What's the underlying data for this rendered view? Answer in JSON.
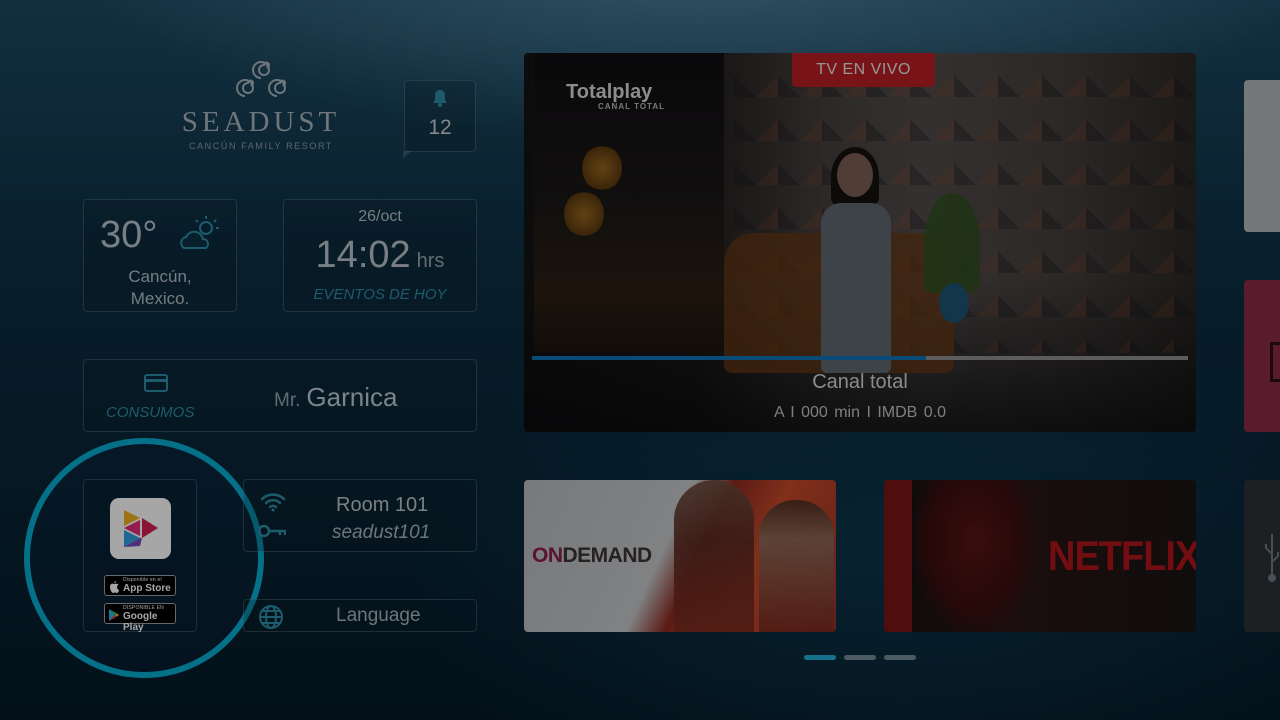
{
  "hotel": {
    "name": "SEADUST",
    "subtitle": "CANCÚN FAMILY RESORT"
  },
  "notifications": {
    "count": "12",
    "icon": "bell-icon"
  },
  "weather": {
    "temperature": "30°",
    "city": "Cancún,",
    "country": "Mexico.",
    "icon": "partly-cloudy-icon"
  },
  "datetime": {
    "date": "26/oct",
    "time": "14:02",
    "unit": "hrs",
    "events_link": "EVENTOS DE HOY"
  },
  "account": {
    "consumos_label": "CONSUMOS",
    "guest_title": "Mr.",
    "guest_name": "Garnica",
    "icon": "credit-card-icon"
  },
  "app": {
    "apple_small": "Disponible en el",
    "apple_big": "App Store",
    "google_small": "DISPONIBLE EN",
    "google_big": "Google Play"
  },
  "room": {
    "name": "Room 101",
    "wifi_password": "seadust101"
  },
  "language": {
    "label": "Language"
  },
  "live_tv": {
    "badge": "TV EN VIVO",
    "channel_logo": "Totalplay",
    "channel_logo_sub": "CANAL TOTAL",
    "title": "Canal total",
    "meta": "A  I  000 min  I  IMDB 0.0",
    "progress": 0.6
  },
  "tiles": {
    "ondemand_on": "ON",
    "ondemand_rest": "DEMAND",
    "netflix": "NETFLIX"
  },
  "pagination": {
    "pages": 3,
    "active": 1
  },
  "colors": {
    "accent": "#08aed3",
    "link": "#2c8ea6",
    "live_badge": "#b82025",
    "progress": "#0d72b8"
  }
}
